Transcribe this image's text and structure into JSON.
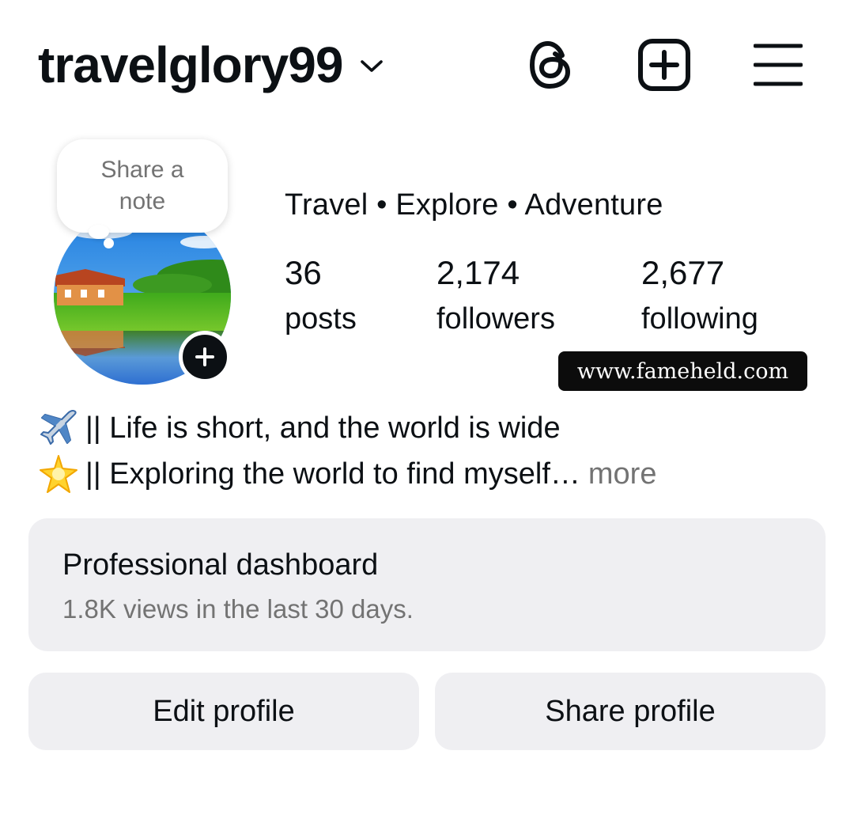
{
  "header": {
    "username": "travelglory99",
    "icons": [
      "chevron-down-icon",
      "threads-icon",
      "new-post-icon",
      "menu-icon"
    ]
  },
  "note": {
    "line1": "Share a",
    "line2": "note"
  },
  "profile": {
    "category": "Travel • Explore • Adventure",
    "stats": {
      "posts": {
        "value": "36",
        "label": "posts"
      },
      "followers": {
        "value": "2,174",
        "label": "followers"
      },
      "following": {
        "value": "2,677",
        "label": "following"
      }
    }
  },
  "watermark": "www.fameheld.com",
  "bio": {
    "line1_text": "|| Life is short, and the world is wide",
    "line2_text": "|| Exploring the world to find myself…",
    "more_label": "more",
    "emojis": [
      "airplane-icon",
      "star-icon"
    ]
  },
  "dashboard": {
    "title": "Professional dashboard",
    "subtitle": "1.8K views in the last 30 days."
  },
  "buttons": {
    "edit": "Edit profile",
    "share": "Share profile"
  },
  "colors": {
    "text": "#0c1014",
    "secondary": "#737373",
    "card_bg": "#efeff2",
    "background": "#ffffff"
  }
}
